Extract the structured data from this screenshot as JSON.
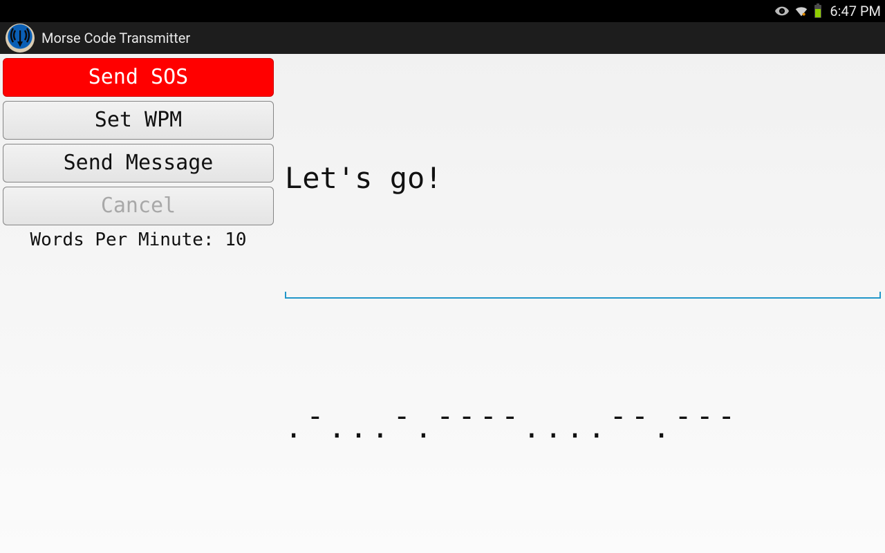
{
  "status": {
    "time": "6:47 PM"
  },
  "app": {
    "title": "Morse Code Transmitter"
  },
  "buttons": {
    "sos": "Send SOS",
    "set_wpm": "Set WPM",
    "send_msg": "Send Message",
    "cancel": "Cancel"
  },
  "wpm": {
    "label": "Words Per Minute: 10",
    "value": 10
  },
  "input": {
    "text": "Let's go!"
  },
  "morse": {
    "output": ".-...-.----....--.---"
  }
}
